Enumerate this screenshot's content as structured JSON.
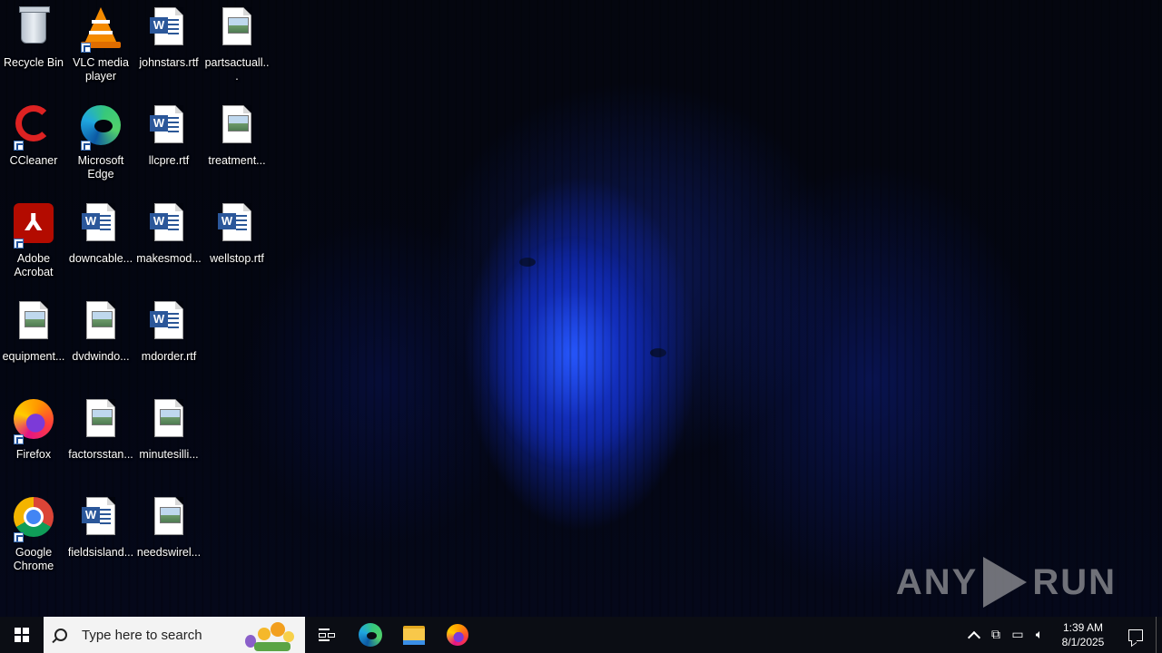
{
  "desktop": {
    "icons": [
      {
        "label": "Recycle Bin",
        "icon": "recycle-bin-icon"
      },
      {
        "label": "VLC media player",
        "icon": "vlc-icon"
      },
      {
        "label": "johnstars.rtf",
        "icon": "word-document-icon"
      },
      {
        "label": "partsactuall...",
        "icon": "image-file-icon"
      },
      {
        "label": "CCleaner",
        "icon": "ccleaner-icon"
      },
      {
        "label": "Microsoft Edge",
        "icon": "edge-icon"
      },
      {
        "label": "llcpre.rtf",
        "icon": "word-document-icon"
      },
      {
        "label": "treatment...",
        "icon": "image-file-icon"
      },
      {
        "label": "Adobe Acrobat",
        "icon": "acrobat-icon"
      },
      {
        "label": "downcable...",
        "icon": "word-document-icon"
      },
      {
        "label": "makesmod...",
        "icon": "word-document-icon"
      },
      {
        "label": "wellstop.rtf",
        "icon": "word-document-icon"
      },
      {
        "label": "equipment...",
        "icon": "image-file-icon"
      },
      {
        "label": "dvdwindo...",
        "icon": "image-file-icon"
      },
      {
        "label": "mdorder.rtf",
        "icon": "word-document-icon"
      },
      {
        "label": "Firefox",
        "icon": "firefox-icon"
      },
      {
        "label": "factorsstan...",
        "icon": "image-file-icon"
      },
      {
        "label": "minutesilli...",
        "icon": "image-file-icon"
      },
      {
        "label": "Google Chrome",
        "icon": "chrome-icon"
      },
      {
        "label": "fieldsisland...",
        "icon": "word-document-icon"
      },
      {
        "label": "needswirel...",
        "icon": "image-file-icon"
      }
    ]
  },
  "watermark": {
    "text_left": "ANY",
    "text_right": "RUN"
  },
  "taskbar": {
    "search_placeholder": "Type here to search",
    "pinned": [
      {
        "name": "Task View",
        "icon": "task-view-icon"
      },
      {
        "name": "Microsoft Edge",
        "icon": "edge-icon"
      },
      {
        "name": "File Explorer",
        "icon": "folder-icon"
      },
      {
        "name": "Firefox",
        "icon": "firefox-icon"
      }
    ],
    "tray": {
      "time": "1:39 AM",
      "date": "8/1/2025"
    }
  }
}
